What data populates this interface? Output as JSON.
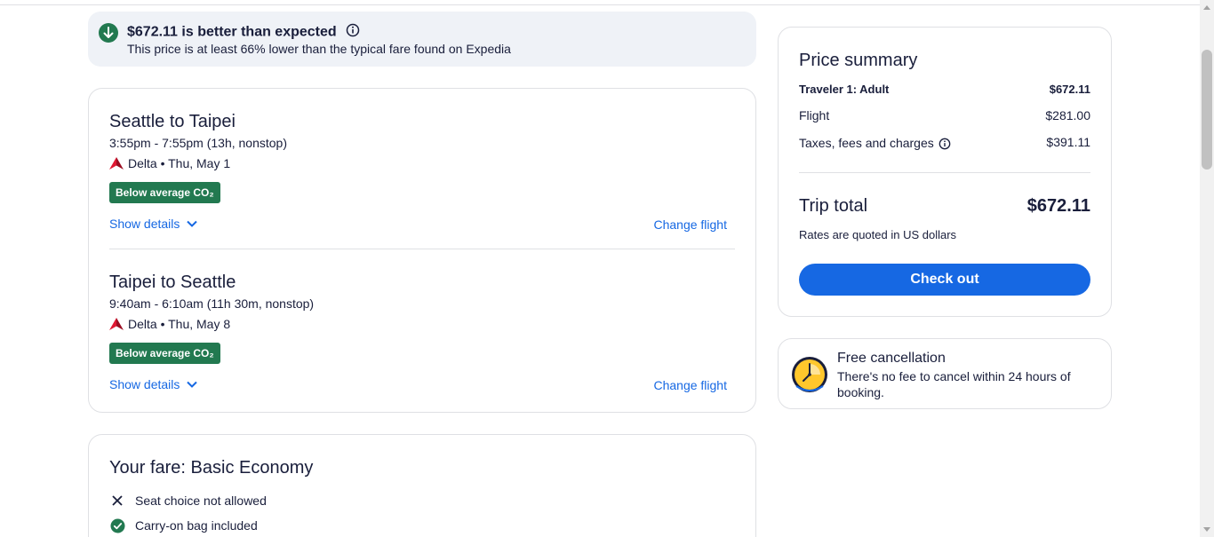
{
  "banner": {
    "title": "$672.11 is better than expected",
    "subtitle": "This price is at least 66% lower than the typical fare found on Expedia"
  },
  "flights": [
    {
      "route": "Seattle to Taipei",
      "time": "3:55pm - 7:55pm (13h, nonstop)",
      "airline_date": "Delta • Thu, May 1",
      "co2_badge": "Below average CO₂",
      "show_details": "Show details",
      "change_flight": "Change flight"
    },
    {
      "route": "Taipei to Seattle",
      "time": "9:40am - 6:10am (11h 30m, nonstop)",
      "airline_date": "Delta • Thu, May 8",
      "co2_badge": "Below average CO₂",
      "show_details": "Show details",
      "change_flight": "Change flight"
    }
  ],
  "fare": {
    "title": "Your fare: Basic Economy",
    "features": [
      {
        "label": "Seat choice not allowed",
        "icon": "x-icon",
        "included": false
      },
      {
        "label": "Carry-on bag included",
        "icon": "check-circle-icon",
        "included": true
      }
    ]
  },
  "price_summary": {
    "title": "Price summary",
    "traveler_label": "Traveler 1: Adult",
    "traveler_amount": "$672.11",
    "flight_label": "Flight",
    "flight_amount": "$281.00",
    "taxes_label": "Taxes, fees and charges",
    "taxes_amount": "$391.11",
    "total_label": "Trip total",
    "total_amount": "$672.11",
    "rates_note": "Rates are quoted in US dollars",
    "checkout_label": "Check out"
  },
  "free_cancellation": {
    "title": "Free cancellation",
    "text": "There's no fee to cancel within 24 hours of booking."
  },
  "colors": {
    "accent_blue": "#1668e3",
    "badge_green": "#227950",
    "delta_red": "#c8102e",
    "text": "#191e3b",
    "banner_bg": "#eff2f7"
  }
}
